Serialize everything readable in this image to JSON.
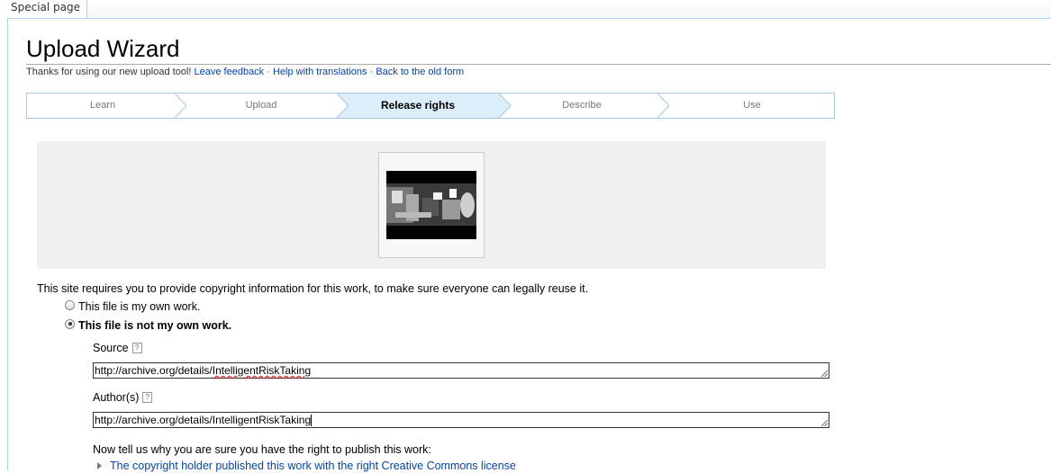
{
  "tabs": {
    "special_page": "Special page"
  },
  "page": {
    "title": "Upload Wizard",
    "thanks": "Thanks for using our new upload tool!",
    "links": {
      "feedback": "Leave feedback",
      "translations": "Help with translations",
      "old_form": "Back to the old form"
    },
    "separator": "·"
  },
  "steps": [
    {
      "label": "Learn",
      "active": false
    },
    {
      "label": "Upload",
      "active": false
    },
    {
      "label": "Release rights",
      "active": true
    },
    {
      "label": "Describe",
      "active": false
    },
    {
      "label": "Use",
      "active": false
    }
  ],
  "rights": {
    "intro": "This site requires you to provide copyright information for this work, to make sure everyone can legally reuse it.",
    "own_work": "This file is my own work.",
    "not_own_work": "This file is not my own work.",
    "selected": "not_own_work"
  },
  "form": {
    "source_label": "Source",
    "source_prefix": "http://archive.org/details/",
    "source_word": "IntelligentRiskTaking",
    "author_label": "Author(s)",
    "author_value": "http://archive.org/details/IntelligentRiskTaking",
    "help_glyph": "?",
    "why_prompt": "Now tell us why you are sure you have the right to publish this work:",
    "cc_option": "The copyright holder published this work with the right Creative Commons license"
  },
  "colors": {
    "link": "#0645ad",
    "active_step": "#dbeefa",
    "step_border": "#a6c8e6"
  }
}
